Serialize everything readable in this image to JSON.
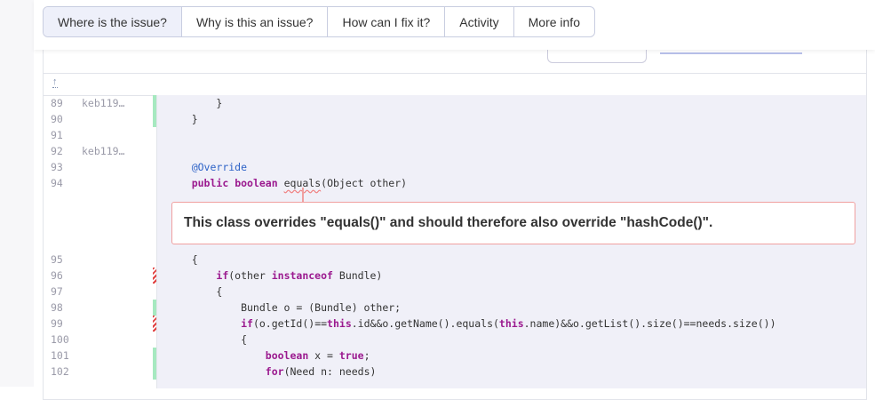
{
  "tabs": [
    "Where is the issue?",
    "Why is this an issue?",
    "How can I fix it?",
    "Activity",
    "More info"
  ],
  "issue_message": "This class overrides \"equals()\" and should therefore also override \"hashCode()\".",
  "expand_icon": "↑",
  "lines_before": [
    {
      "num": "89",
      "author": "keb119…",
      "marker": "g",
      "code": [
        [
          "p",
          "        }"
        ]
      ]
    },
    {
      "num": "90",
      "author": "",
      "marker": "g",
      "code": [
        [
          "p",
          "    }"
        ]
      ]
    },
    {
      "num": "91",
      "author": "",
      "marker": "",
      "code": []
    },
    {
      "num": "92",
      "author": "keb119…",
      "marker": "",
      "code": []
    },
    {
      "num": "93",
      "author": "",
      "marker": "",
      "code": [
        [
          "p",
          "    "
        ],
        [
          "a",
          "@Override"
        ]
      ]
    },
    {
      "num": "94",
      "author": "",
      "marker": "",
      "code": [
        [
          "p",
          "    "
        ],
        [
          "k",
          "public"
        ],
        [
          "p",
          " "
        ],
        [
          "k",
          "boolean"
        ],
        [
          "p",
          " "
        ],
        [
          "sq",
          "equals"
        ],
        [
          "p",
          "(Object other)"
        ]
      ]
    }
  ],
  "lines_after": [
    {
      "num": "95",
      "author": "",
      "marker": "",
      "code": [
        [
          "p",
          "    {"
        ]
      ]
    },
    {
      "num": "96",
      "author": "",
      "marker": "r",
      "code": [
        [
          "p",
          "        "
        ],
        [
          "k",
          "if"
        ],
        [
          "p",
          "(other "
        ],
        [
          "k",
          "instanceof"
        ],
        [
          "p",
          " Bundle)"
        ]
      ]
    },
    {
      "num": "97",
      "author": "",
      "marker": "",
      "code": [
        [
          "p",
          "        {"
        ]
      ]
    },
    {
      "num": "98",
      "author": "",
      "marker": "g",
      "code": [
        [
          "p",
          "            Bundle o = (Bundle) other;"
        ]
      ]
    },
    {
      "num": "99",
      "author": "",
      "marker": "r",
      "code": [
        [
          "p",
          "            "
        ],
        [
          "k",
          "if"
        ],
        [
          "p",
          "(o.getId()=="
        ],
        [
          "k",
          "this"
        ],
        [
          "p",
          ".id&&o.getName().equals("
        ],
        [
          "k",
          "this"
        ],
        [
          "p",
          ".name)&&o.getList().size()==needs.size())"
        ]
      ]
    },
    {
      "num": "100",
      "author": "",
      "marker": "",
      "code": [
        [
          "p",
          "            {"
        ]
      ]
    },
    {
      "num": "101",
      "author": "",
      "marker": "g",
      "code": [
        [
          "p",
          "                "
        ],
        [
          "k",
          "boolean"
        ],
        [
          "p",
          " x = "
        ],
        [
          "k",
          "true"
        ],
        [
          "p",
          ";"
        ]
      ]
    },
    {
      "num": "102",
      "author": "",
      "marker": "g",
      "code": [
        [
          "p",
          "                "
        ],
        [
          "k",
          "for"
        ],
        [
          "p",
          "(Need n: needs)"
        ]
      ]
    }
  ]
}
